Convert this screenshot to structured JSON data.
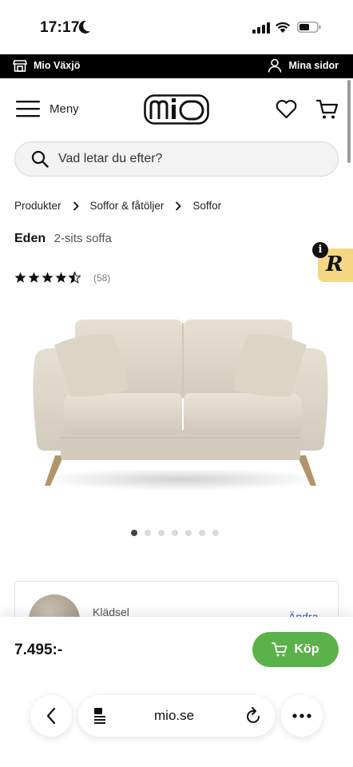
{
  "status_bar": {
    "time": "17:17"
  },
  "topbar": {
    "store_label": "Mio Växjö",
    "account_label": "Mina sidor"
  },
  "header": {
    "menu_label": "Meny",
    "logo_text": "mio"
  },
  "search": {
    "placeholder": "Vad letar du efter?"
  },
  "breadcrumb": [
    "Produkter",
    "Soffor & fåtöljer",
    "Soffor"
  ],
  "product": {
    "name": "Eden",
    "subtitle": "2-sits soffa",
    "rating": 4.5,
    "rating_max": 5,
    "review_count": "(58)",
    "image_count": 7,
    "active_image": 1
  },
  "badge": {
    "letter": "R",
    "info": "i"
  },
  "fabric": {
    "label": "Klädsel",
    "action": "Ändra"
  },
  "pricebar": {
    "price": "7.495:-",
    "buy_label": "Köp"
  },
  "safari": {
    "url": "mio.se"
  },
  "colors": {
    "buy_green": "#5cb24a",
    "topbar": "#000000",
    "badge_yellow": "#f5d783"
  }
}
